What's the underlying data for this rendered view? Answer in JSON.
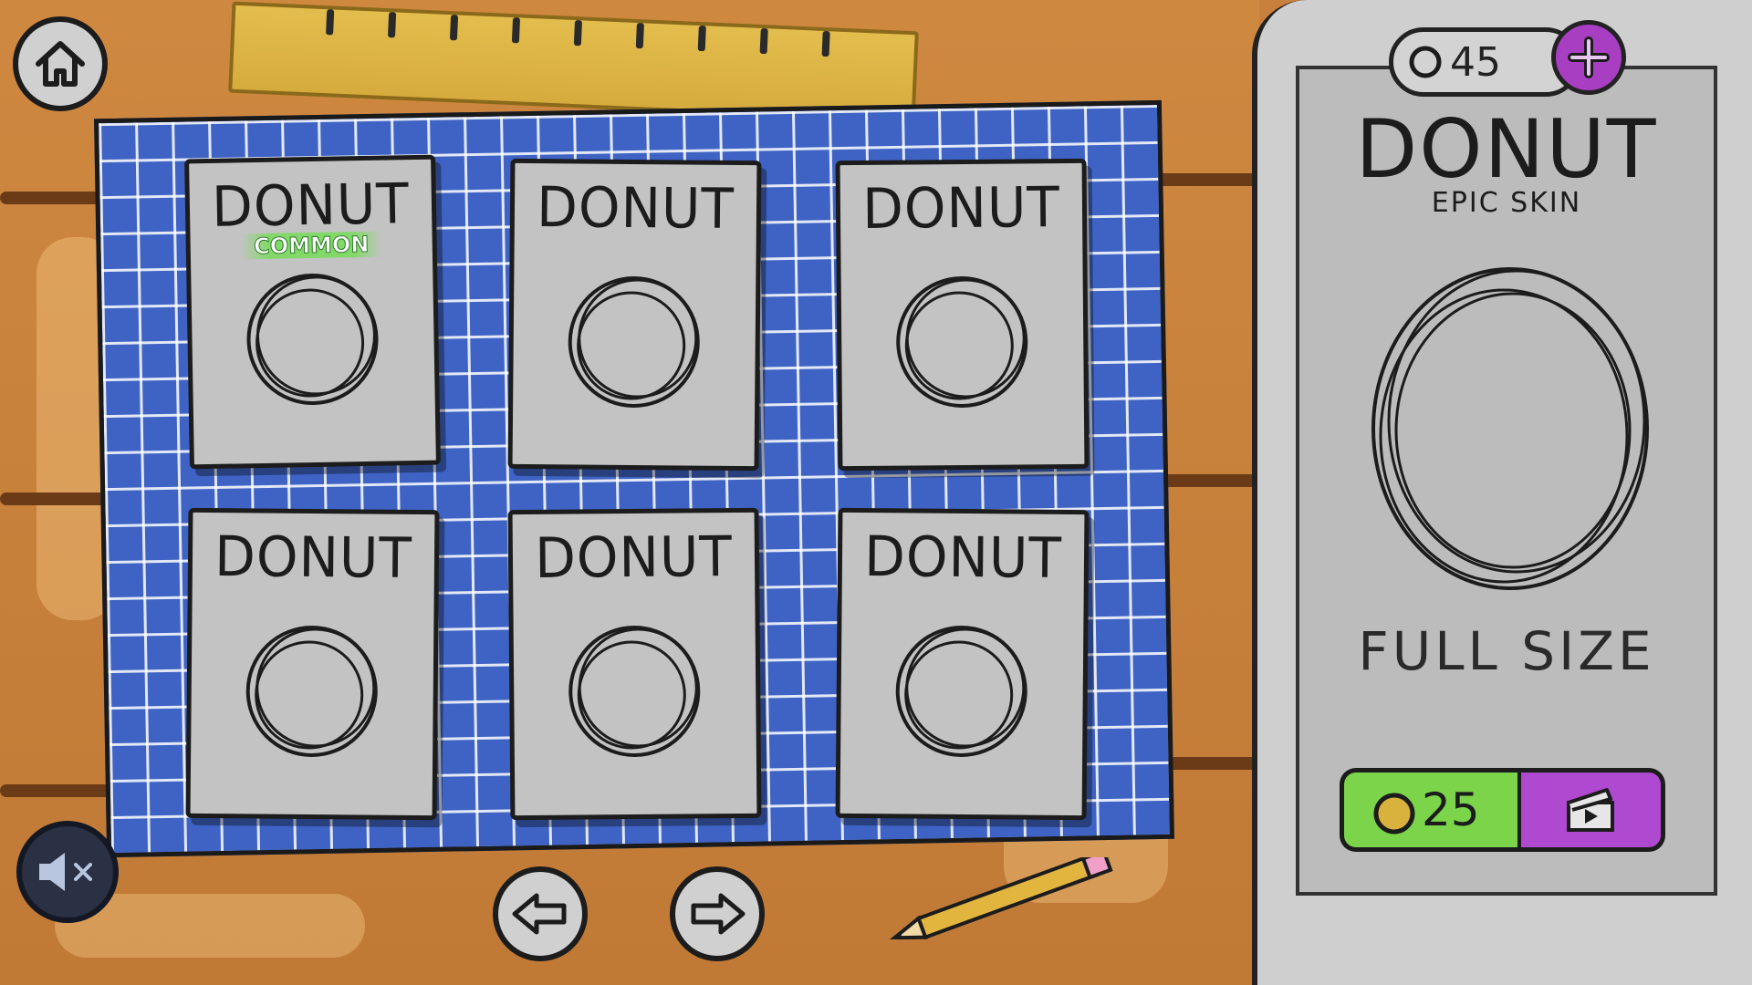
{
  "currency": {
    "balance": "45"
  },
  "grid": {
    "cards": [
      {
        "name": "DONUT",
        "rarity": "COMMON"
      },
      {
        "name": "DONUT",
        "rarity": ""
      },
      {
        "name": "DONUT",
        "rarity": ""
      },
      {
        "name": "DONUT",
        "rarity": ""
      },
      {
        "name": "DONUT",
        "rarity": ""
      },
      {
        "name": "DONUT",
        "rarity": ""
      }
    ]
  },
  "detail": {
    "title": "DONUT",
    "subtitle": "EPIC SKIN",
    "preview_label": "FULL SIZE",
    "price": "25"
  },
  "icons": {
    "home": "home-icon",
    "mute": "speaker-muted-icon",
    "prev": "arrow-left-icon",
    "next": "arrow-right-icon",
    "add": "plus-icon",
    "coin": "coin-icon",
    "ad": "video-ad-icon"
  },
  "colors": {
    "board": "#3f63c4",
    "wood": "#c9803c",
    "buy": "#7bd44a",
    "ad": "#ae49d0",
    "plus": "#a83fc2"
  }
}
